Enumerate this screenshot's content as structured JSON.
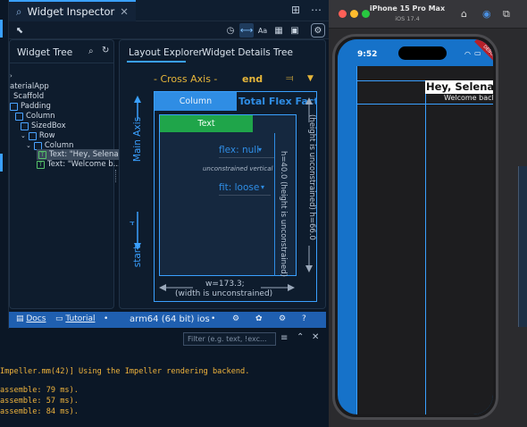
{
  "ide": {
    "tab_title": "Widget Inspector",
    "tree_title": "Widget Tree",
    "tree_nodes": [
      {
        "label": "aterialApp"
      },
      {
        "label": "Scaffold"
      },
      {
        "label": "Padding"
      },
      {
        "label": "Column"
      },
      {
        "label": "SizedBox"
      },
      {
        "label": "Row"
      },
      {
        "label": "Column"
      },
      {
        "label": "Text: \"Hey, Selena\""
      },
      {
        "label": "Text: \"Welcome b..."
      }
    ],
    "tabs": {
      "layout_explorer": "Layout Explorer",
      "widget_details": "Widget Details Tree"
    },
    "cross_axis_label": "- Cross Axis -",
    "cross_axis_value": "end",
    "main_axis_label": "Main Axis",
    "main_axis_value": "start",
    "column_label": "Column",
    "total_flex_label": "Total Flex Fact...",
    "text_box_label": "Text",
    "flex_value": "flex: null",
    "unconstrained_vertical": "unconstrained vertical",
    "fit_value": "fit: loose",
    "height_outer": "(height is unconstrained)",
    "h_outer": "h=66.0",
    "height_inner": "(height is unconstrained)",
    "h_inner": "h=40.0",
    "width_value": "w=173.3;",
    "width_note": "(width is unconstrained)"
  },
  "status": {
    "docs": "Docs",
    "tutorial": "Tutorial",
    "target": "arm64 (64 bit) ios"
  },
  "console": {
    "filter_placeholder": "Filter (e.g. text, !exc...",
    "lines": [
      "Impeller.mm(42)] Using the Impeller rendering backend.",
      "assemble: 79 ms).",
      "assemble: 57 ms).",
      "assemble: 84 ms)."
    ]
  },
  "simulator": {
    "device": "iPhone 15 Pro Max",
    "os": "iOS 17.4",
    "time": "9:52",
    "debug": "DEBUG",
    "greeting": "Hey, Selena",
    "welcome": "Welcome back"
  },
  "colors": {
    "accent": "#3aa0ff",
    "text_green": "#1fa54a",
    "flex_blue": "#2f8de4",
    "console_orange": "#f0b43c"
  }
}
